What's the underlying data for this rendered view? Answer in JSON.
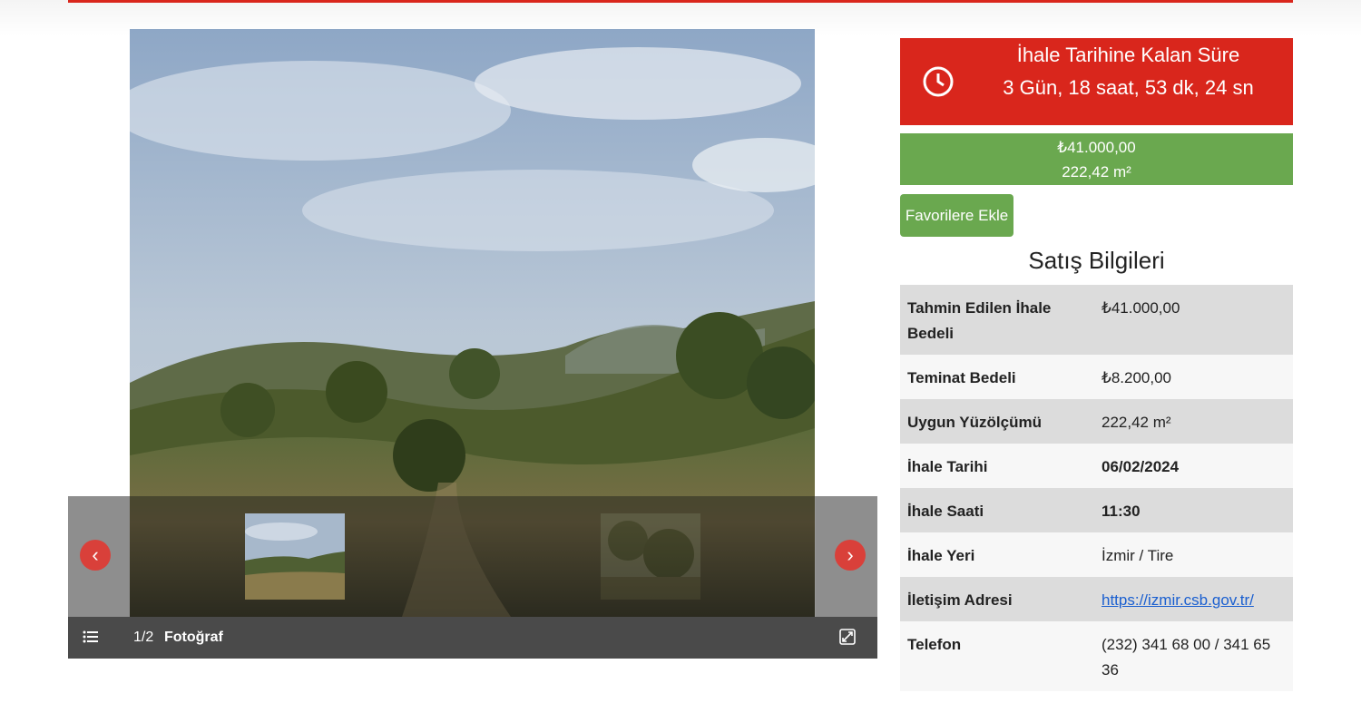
{
  "countdown": {
    "title": "İhale Tarihine Kalan Süre",
    "time": "3 Gün, 18 saat, 53 dk, 24 sn"
  },
  "price": {
    "amount": "₺41.000,00",
    "area": "222,42 m²"
  },
  "favorite_button": "Favorilere Ekle",
  "section_title": "Satış Bilgileri",
  "rows": [
    {
      "label": "Tahmin Edilen İhale Bedeli",
      "value": "₺41.000,00"
    },
    {
      "label": "Teminat Bedeli",
      "value": "₺8.200,00"
    },
    {
      "label": "Uygun Yüzölçümü",
      "value": "222,42 m²"
    },
    {
      "label": "İhale Tarihi",
      "value": "06/02/2024"
    },
    {
      "label": "İhale Saati",
      "value": "11:30"
    },
    {
      "label": "İhale Yeri",
      "value": "İzmir / Tire"
    },
    {
      "label": "İletişim Adresi",
      "value": "https://izmir.csb.gov.tr/"
    },
    {
      "label": "Telefon",
      "value": "(232) 341 68 00 / 341 65 36"
    }
  ],
  "gallery": {
    "counter": "1/2",
    "caption": "Fotoğraf"
  },
  "colors": {
    "accent_red": "#d9261c",
    "accent_green": "#6aa84f",
    "link_blue": "#1a5fd0"
  },
  "icons": [
    "clock-icon",
    "chevron-left-icon",
    "chevron-right-icon",
    "list-icon",
    "expand-icon"
  ]
}
